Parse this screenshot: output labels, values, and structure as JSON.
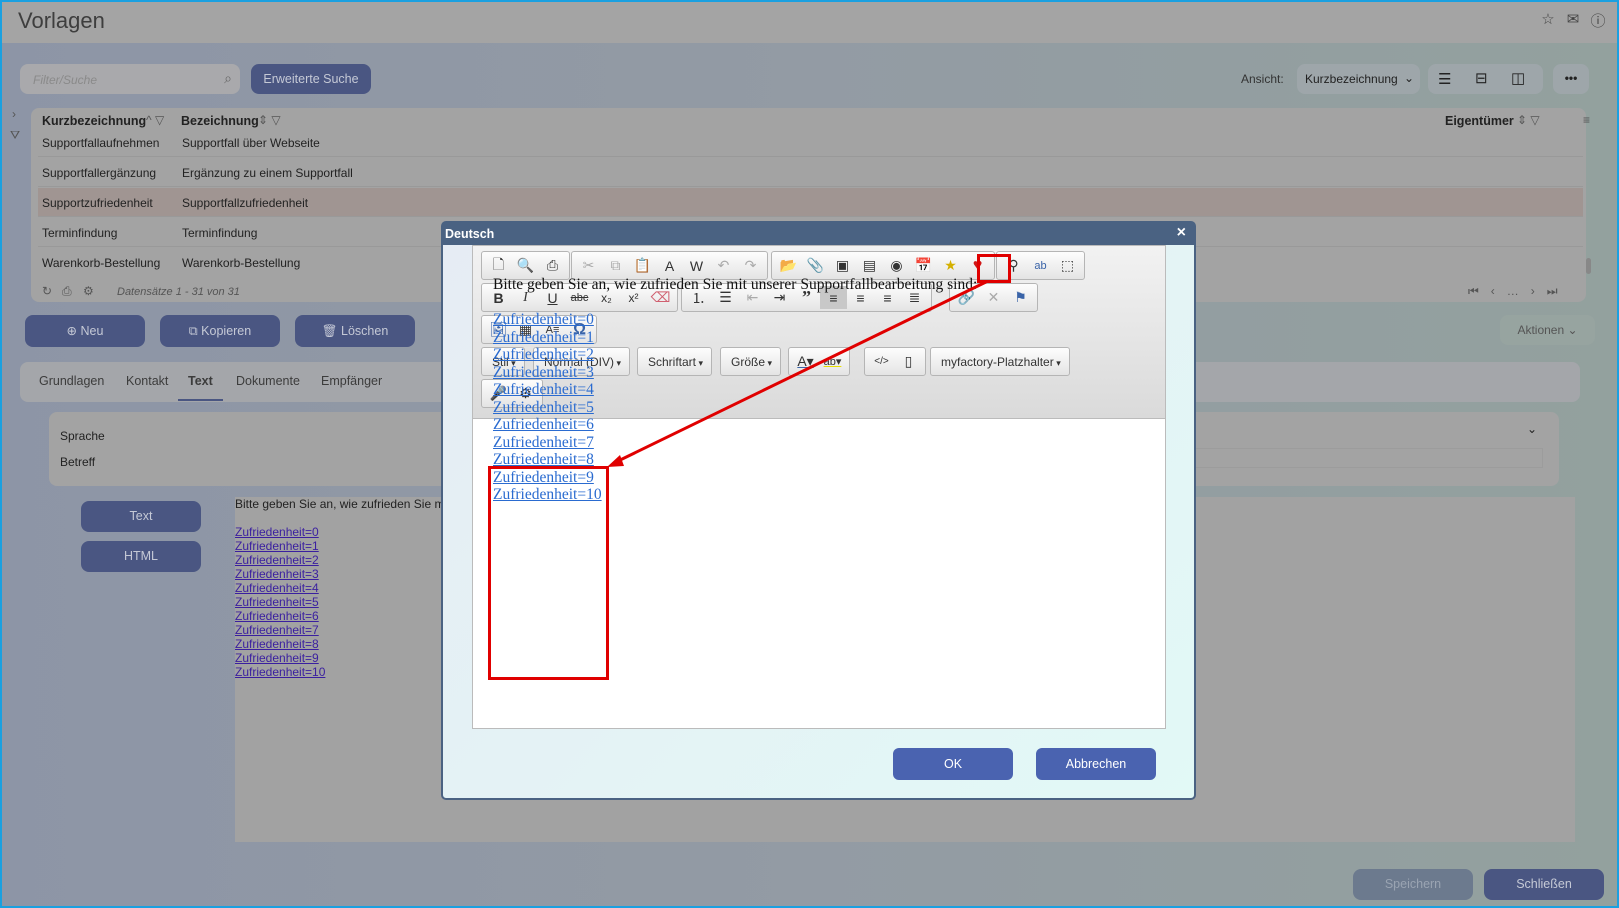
{
  "app": {
    "title": "Vorlagen"
  },
  "search": {
    "placeholder": "Filter/Suche",
    "advanced_label": "Erweiterte Suche"
  },
  "view": {
    "label": "Ansicht:",
    "selected": "Kurzbezeichnung"
  },
  "grid": {
    "columns": [
      "Kurzbezeichnung",
      "Bezeichnung",
      "Eigentümer"
    ],
    "rows": [
      {
        "short": "Supportfallaufnehmen",
        "name": "Supportfall über Webseite"
      },
      {
        "short": "Supportfallergänzung",
        "name": "Ergänzung zu einem Supportfall"
      },
      {
        "short": "Supportzufriedenheit",
        "name": "Supportfallzufriedenheit",
        "selected": true
      },
      {
        "short": "Terminfindung",
        "name": "Terminfindung"
      },
      {
        "short": "Warenkorb-Bestellung",
        "name": "Warenkorb-Bestellung"
      }
    ],
    "status": "Datensätze 1 - 31 von 31"
  },
  "actions": {
    "new": "Neu",
    "copy": "Kopieren",
    "delete": "Löschen",
    "more": "Aktionen"
  },
  "tabs": [
    "Grundlagen",
    "Kontakt",
    "Text",
    "Dokumente",
    "Empfänger"
  ],
  "active_tab": "Text",
  "form": {
    "language_label": "Sprache",
    "subject_label": "Betreff"
  },
  "mode_buttons": {
    "text": "Text",
    "html": "HTML"
  },
  "preview": {
    "intro": "Bitte geben Sie an, wie zufrieden Sie m",
    "links": [
      "Zufriedenheit=0",
      "Zufriedenheit=1",
      "Zufriedenheit=2",
      "Zufriedenheit=3",
      "Zufriedenheit=4",
      "Zufriedenheit=5",
      "Zufriedenheit=6",
      "Zufriedenheit=7",
      "Zufriedenheit=8",
      "Zufriedenheit=9",
      "Zufriedenheit=10"
    ]
  },
  "footer": {
    "save": "Speichern",
    "close": "Schließen"
  },
  "dialog": {
    "title": "Deutsch",
    "close": "×",
    "dropdowns": {
      "style": "Stil",
      "format": "Normal (DIV)",
      "font": "Schriftart",
      "size": "Größe",
      "placeholder": "myfactory-Platzhalter"
    },
    "intro": "Bitte geben Sie an, wie zufrieden Sie mit unserer Supportfallbearbeitung sind:",
    "links": [
      "Zufriedenheit=0",
      "Zufriedenheit=1",
      "Zufriedenheit=2",
      "Zufriedenheit=3",
      "Zufriedenheit=4",
      "Zufriedenheit=5",
      "Zufriedenheit=6",
      "Zufriedenheit=7",
      "Zufriedenheit=8",
      "Zufriedenheit=9",
      "Zufriedenheit=10"
    ],
    "ok": "OK",
    "cancel": "Abbrechen"
  },
  "colors": {
    "accent": "#4a5682",
    "dialog_header": "#4a6282",
    "annotation": "#e00000"
  }
}
